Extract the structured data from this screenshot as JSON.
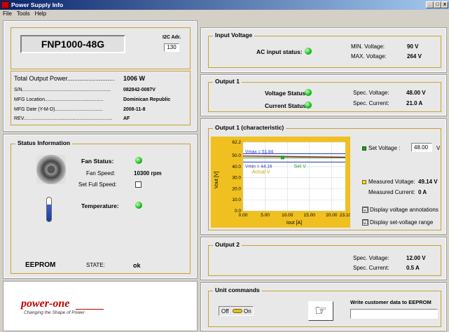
{
  "window": {
    "title": "Power Supply Info",
    "min": "_",
    "max": "□",
    "close": "x"
  },
  "menu": {
    "file": "File",
    "tools": "Tools",
    "help": "Help"
  },
  "device": {
    "model": "FNP1000-48G",
    "i2c_label": "I2C Adr.",
    "i2c_value": "130"
  },
  "info": {
    "total_power_label": "Total Output Power...........................",
    "total_power_value": "1006 W",
    "sn_label": "S/N.................................................................",
    "sn_value": "082842-0087V",
    "mfg_loc_label": "MFG Location...........................................",
    "mfg_loc_value": "Dominican Republic",
    "mfg_date_label": "MFG Date (Y-M-D)...................................",
    "mfg_date_value": "2008-11-8",
    "rev_label": "REV.................................................................",
    "rev_value": "AF"
  },
  "status": {
    "title": "Status Information",
    "fan_status": "Fan Status:",
    "fan_speed_label": "Fan Speed:",
    "fan_speed_value": "10300 rpm",
    "set_full_speed": "Set Full Speed:",
    "temperature": "Temperature:",
    "eeprom": "EEPROM",
    "state_label": "STATE:",
    "state_value": "ok"
  },
  "input_voltage": {
    "title": "Input Voltage",
    "ac_status": "AC input status:",
    "min_label": "MIN. Voltage:",
    "min_value": "90 V",
    "max_label": "MAX. Voltage:",
    "max_value": "264 V"
  },
  "output1": {
    "title": "Output 1",
    "voltage_status": "Voltage Status",
    "current_status": "Current Status",
    "spec_voltage_label": "Spec. Voltage:",
    "spec_voltage_value": "48.00 V",
    "spec_current_label": "Spec. Current:",
    "spec_current_value": "21.0 A"
  },
  "char": {
    "title": "Output 1  (characteristic)",
    "set_voltage_label": "Set Voltage :",
    "set_voltage_value": "48.00",
    "set_voltage_unit": "V",
    "measured_voltage_label": "Measured Voltage:",
    "measured_voltage_value": "49.14 V",
    "measured_current_label": "Measured Current:",
    "measured_current_value": "0 A",
    "opt_annotations": "Display voltage annotations",
    "opt_range": "Display set-voltage range",
    "check": "☑"
  },
  "chart_data": {
    "type": "line",
    "xlabel": "Iout [A]",
    "ylabel": "Vout [V]",
    "xlim": [
      0,
      23.1
    ],
    "ylim": [
      0,
      62.2
    ],
    "xticks": [
      "0.00",
      "5.00",
      "10.00",
      "15.00",
      "20.00",
      "23.10"
    ],
    "yticks": [
      "0.0",
      "10.0",
      "20.0",
      "30.0",
      "40.0",
      "50.0",
      "62.2"
    ],
    "vmax": 51.84,
    "vmin": 44.16,
    "vmax_label": "Vmax = 51.84",
    "vmin_label": "Vmin = 44.16",
    "series": [
      {
        "name": "Set V",
        "x": [
          0,
          23.1
        ],
        "y": [
          48,
          48
        ]
      },
      {
        "name": "Actual V",
        "x": [
          0,
          23.1
        ],
        "y": [
          49.6,
          48.6
        ]
      }
    ]
  },
  "output2": {
    "title": "Output 2",
    "spec_voltage_label": "Spec. Voltage:",
    "spec_voltage_value": "12.00 V",
    "spec_current_label": "Spec. Current:",
    "spec_current_value": "0.5 A"
  },
  "unit": {
    "title": "Unit commands",
    "off": "Off",
    "on": "On",
    "write_label": "Write customer data to EEPROM"
  },
  "logo": {
    "brand": "power-one",
    "tagline": "Changing the Shape of Power"
  }
}
